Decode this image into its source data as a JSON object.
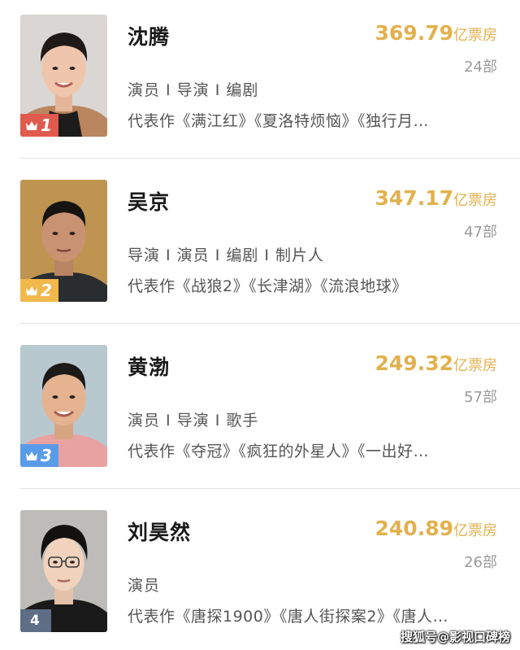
{
  "colors": {
    "boxoffice": "#e1b14d",
    "rank1": "#e05a4e",
    "rank2": "#f2b84b",
    "rank3": "#5a9be8",
    "rank4": "#5d6e86"
  },
  "items": [
    {
      "rank": "1",
      "name": "沈腾",
      "box_office": "369.79",
      "unit": "亿票房",
      "film_count": "24部",
      "roles": "演员 I 导演 I 编剧",
      "works": "代表作《满江红》《夏洛特烦恼》《独行月…",
      "photo": "portrait-shen-teng"
    },
    {
      "rank": "2",
      "name": "吴京",
      "box_office": "347.17",
      "unit": "亿票房",
      "film_count": "47部",
      "roles": "导演 I 演员 I 编剧 I 制片人",
      "works": "代表作《战狼2》《长津湖》《流浪地球》",
      "photo": "portrait-wu-jing"
    },
    {
      "rank": "3",
      "name": "黄渤",
      "box_office": "249.32",
      "unit": "亿票房",
      "film_count": "57部",
      "roles": "演员 I 导演 I 歌手",
      "works": "代表作《夺冠》《疯狂的外星人》《一出好…",
      "photo": "portrait-huang-bo"
    },
    {
      "rank": "4",
      "name": "刘昊然",
      "box_office": "240.89",
      "unit": "亿票房",
      "film_count": "26部",
      "roles": "演员",
      "works": "代表作《唐探1900》《唐人街探案2》《唐人…",
      "photo": "portrait-liu-haoran"
    }
  ],
  "watermark": "搜狐号@影视口碑榜"
}
